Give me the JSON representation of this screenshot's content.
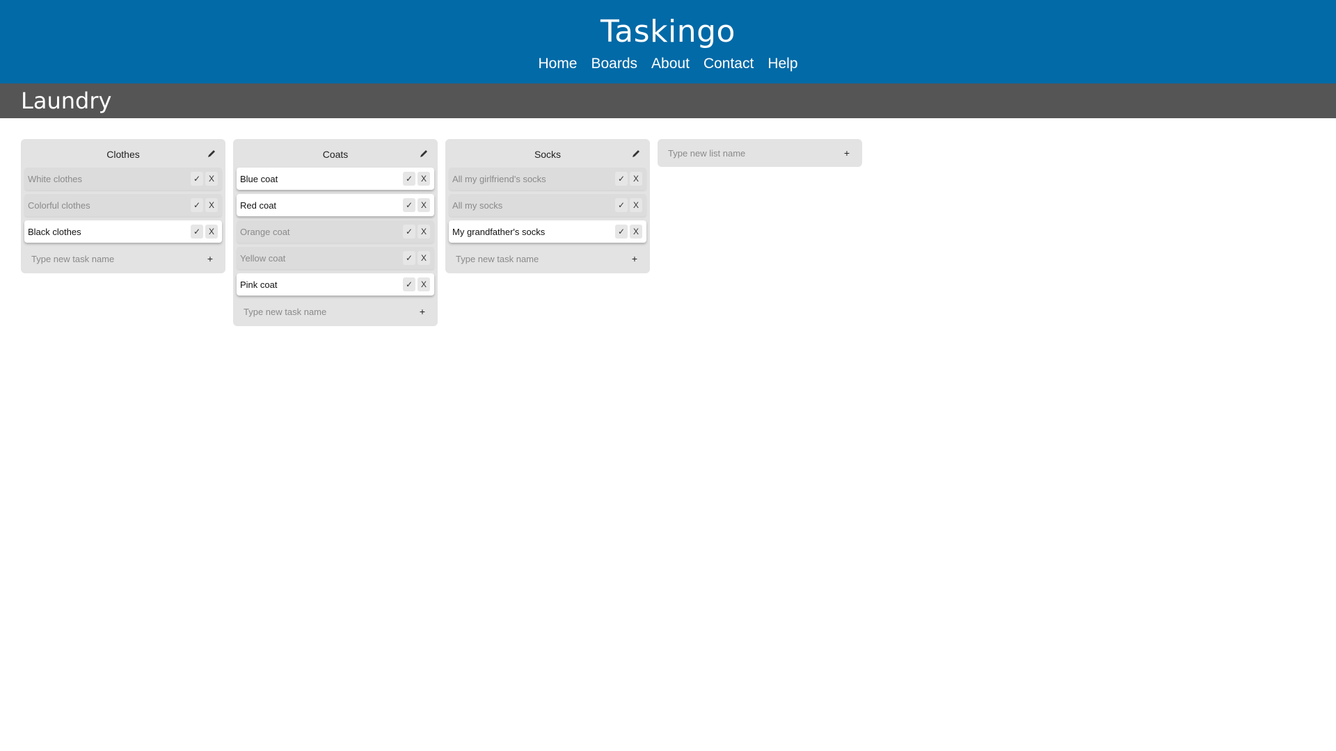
{
  "app": {
    "title": "Taskingo",
    "nav": [
      "Home",
      "Boards",
      "About",
      "Contact",
      "Help"
    ]
  },
  "board": {
    "title": "Laundry"
  },
  "lists": [
    {
      "name": "Clothes",
      "tasks": [
        {
          "label": "White clothes",
          "done": true
        },
        {
          "label": "Colorful clothes",
          "done": true
        },
        {
          "label": "Black clothes",
          "done": false
        }
      ],
      "new_task_placeholder": "Type new task name"
    },
    {
      "name": "Coats",
      "tasks": [
        {
          "label": "Blue coat",
          "done": false
        },
        {
          "label": "Red coat",
          "done": false
        },
        {
          "label": "Orange coat",
          "done": true
        },
        {
          "label": "Yellow coat",
          "done": true
        },
        {
          "label": "Pink coat",
          "done": false
        }
      ],
      "new_task_placeholder": "Type new task name"
    },
    {
      "name": "Socks",
      "tasks": [
        {
          "label": "All my girlfriend's socks",
          "done": true
        },
        {
          "label": "All my socks",
          "done": true
        },
        {
          "label": "My grandfather's socks",
          "done": false
        }
      ],
      "new_task_placeholder": "Type new task name"
    }
  ],
  "task_actions": {
    "check_label": "✓",
    "delete_label": "X"
  },
  "new_list": {
    "placeholder": "Type new list name",
    "add_label": "+"
  },
  "new_task_add_label": "+",
  "icons": {
    "edit": "pencil-icon"
  },
  "colors": {
    "header": "#026aa7",
    "board_bar": "#555555",
    "list_bg": "#e3e3e3"
  }
}
